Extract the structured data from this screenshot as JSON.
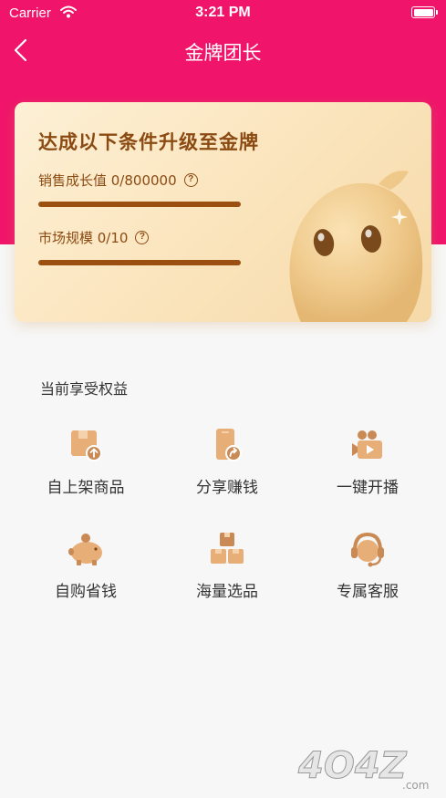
{
  "status_bar": {
    "carrier": "Carrier",
    "time": "3:21 PM"
  },
  "nav": {
    "title": "金牌团长"
  },
  "card": {
    "heading": "达成以下条件升级至金牌",
    "requirements": [
      {
        "label": "销售成长值 0/800000",
        "progress": 0
      },
      {
        "label": "市场规模 0/10",
        "progress": 0
      }
    ]
  },
  "benefits": {
    "title": "当前享受权益",
    "items": [
      {
        "label": "自上架商品",
        "icon": "box-upload-icon"
      },
      {
        "label": "分享赚钱",
        "icon": "share-phone-icon"
      },
      {
        "label": "一键开播",
        "icon": "video-camera-icon"
      },
      {
        "label": "自购省钱",
        "icon": "piggy-bank-icon"
      },
      {
        "label": "海量选品",
        "icon": "stacked-boxes-icon"
      },
      {
        "label": "专属客服",
        "icon": "headset-icon"
      }
    ]
  },
  "watermark": {
    "text": "4O4Z",
    "suffix": ".com"
  },
  "colors": {
    "brand": "#f0156b",
    "gold_text": "#8b4a12",
    "icon": "#e0a070"
  }
}
